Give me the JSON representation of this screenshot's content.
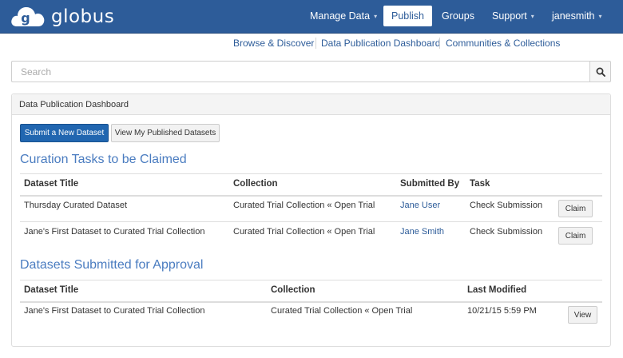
{
  "brand": {
    "name": "globus",
    "logo_letter": "g",
    "color": "#2d5c99"
  },
  "topnav": {
    "items": [
      {
        "label": "Manage Data",
        "dropdown": true
      },
      {
        "label": "Publish",
        "active": true
      },
      {
        "label": "Groups"
      },
      {
        "label": "Support",
        "dropdown": true
      },
      {
        "label": "janesmith",
        "dropdown": true
      }
    ],
    "caret": "▾"
  },
  "subnav": {
    "links": [
      "Browse & Discover",
      "Data Publication Dashboard",
      "Communities & Collections"
    ]
  },
  "search": {
    "placeholder": "Search",
    "value": "",
    "icon": "search-icon"
  },
  "panel": {
    "title": "Data Publication Dashboard",
    "buttons": {
      "submit": "Submit a New Dataset",
      "view_published": "View My Published Datasets"
    }
  },
  "curation": {
    "title": "Curation Tasks to be Claimed",
    "headers": [
      "Dataset Title",
      "Collection",
      "Submitted By",
      "Task"
    ],
    "rows": [
      {
        "title": "Thursday Curated Dataset",
        "collection": "Curated Trial Collection « Open Trial",
        "submitted_by": "Jane User",
        "task": "Check Submission",
        "action": "Claim"
      },
      {
        "title": "Jane's First Dataset to Curated Trial Collection",
        "collection": "Curated Trial Collection « Open Trial",
        "submitted_by": "Jane Smith",
        "task": "Check Submission",
        "action": "Claim"
      }
    ]
  },
  "submitted": {
    "title": "Datasets Submitted for Approval",
    "headers": [
      "Dataset Title",
      "Collection",
      "Last Modified"
    ],
    "rows": [
      {
        "title": "Jane's First Dataset to Curated Trial Collection",
        "collection": "Curated Trial Collection « Open Trial",
        "last_modified": "10/21/15 5:59 PM",
        "action": "View"
      }
    ]
  }
}
